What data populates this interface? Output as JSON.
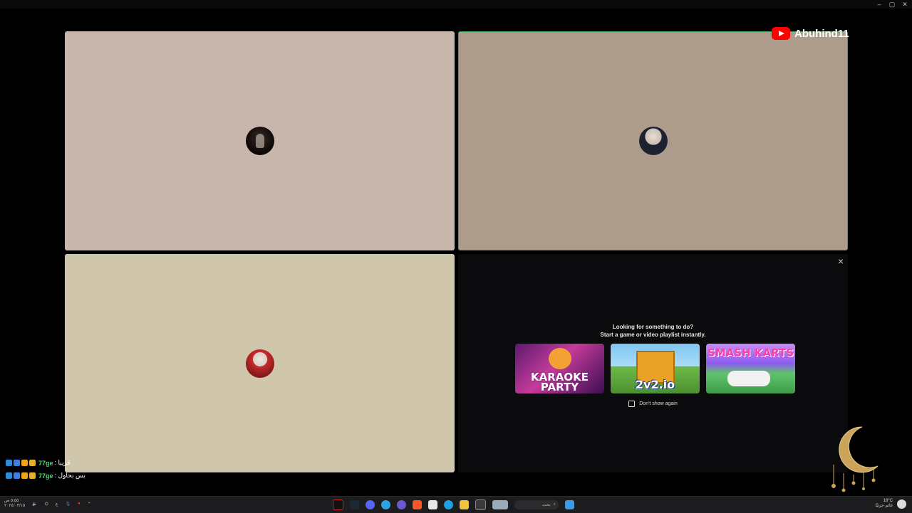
{
  "window": {
    "minimize": "–",
    "maximize": "▢",
    "close": "✕"
  },
  "participants": [
    {
      "id": "p1",
      "tile_color": "#c8b5ab"
    },
    {
      "id": "p2",
      "tile_color": "#ad9c8b",
      "speaking": true
    },
    {
      "id": "p3",
      "tile_color": "#d0c6ab"
    }
  ],
  "activity": {
    "close_label": "×",
    "line1": "Looking for something to do?",
    "line2": "Start a game or video playlist instantly.",
    "games": [
      {
        "title": "KARAOKE PARTY",
        "icon": "karaoke-party-thumbnail"
      },
      {
        "title": "2v2.io",
        "icon": "2v2io-thumbnail"
      },
      {
        "title": "SMASH KARTS",
        "icon": "smash-karts-thumbnail"
      }
    ],
    "dont_show_label": "Don't show again"
  },
  "overlay": {
    "channel_name": "Abuhind11",
    "channel_icon": "youtube-icon",
    "chat": [
      {
        "user": "77ge",
        "message": ": قريبا"
      },
      {
        "user": "77ge",
        "message": ": بس بحاول"
      }
    ]
  },
  "taskbar": {
    "date_line1": "٥:٥٥ ص",
    "date_line2": "٢٠٢٤/٠٣/١٥",
    "search_placeholder": "بحث",
    "weather_temp": "18°C",
    "weather_text": "غائم جزئيًا"
  }
}
